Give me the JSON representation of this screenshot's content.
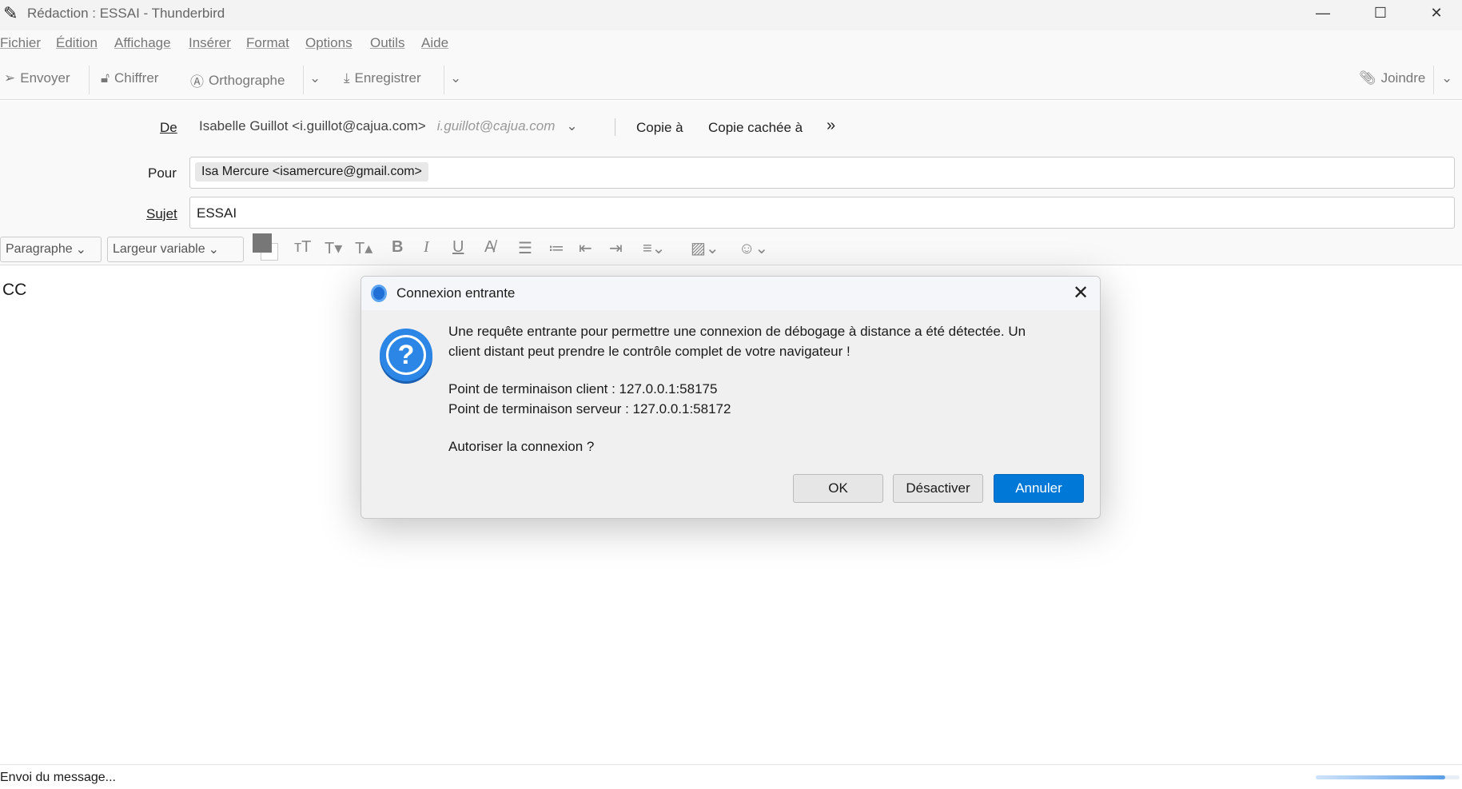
{
  "window": {
    "title": "Rédaction : ESSAI - Thunderbird"
  },
  "menu": [
    "Fichier",
    "Édition",
    "Affichage",
    "Insérer",
    "Format",
    "Options",
    "Outils",
    "Aide"
  ],
  "toolbar": {
    "send": "Envoyer",
    "encrypt": "Chiffrer",
    "spelling": "Orthographe",
    "save": "Enregistrer",
    "attach": "Joindre"
  },
  "compose": {
    "from_label": "De",
    "from_value": "Isabelle Guillot <i.guillot@cajua.com>",
    "from_identity": "i.guillot@cajua.com",
    "cc_label": "Copie à",
    "bcc_label": "Copie cachée à",
    "to_label": "Pour",
    "to_recipient": "Isa Mercure <isamercure@gmail.com>",
    "subject_label": "Sujet",
    "subject_value": "ESSAI"
  },
  "format": {
    "paragraph": "Paragraphe",
    "font": "Largeur variable"
  },
  "body": {
    "text": "CC"
  },
  "status": {
    "text": "Envoi du message...",
    "progress": 0.9
  },
  "dialog": {
    "title": "Connexion entrante",
    "message_lines": [
      "Une requête entrante pour permettre une connexion de débogage à distance a été détectée. Un",
      "client distant peut prendre le contrôle complet de votre navigateur !"
    ],
    "client_endpoint": "Point de terminaison client : 127.0.0.1:58175",
    "server_endpoint": "Point de terminaison serveur : 127.0.0.1:58172",
    "question": "Autoriser la connexion ?",
    "ok": "OK",
    "disable": "Désactiver",
    "cancel": "Annuler"
  },
  "colors": {
    "accent": "#0078d7"
  }
}
